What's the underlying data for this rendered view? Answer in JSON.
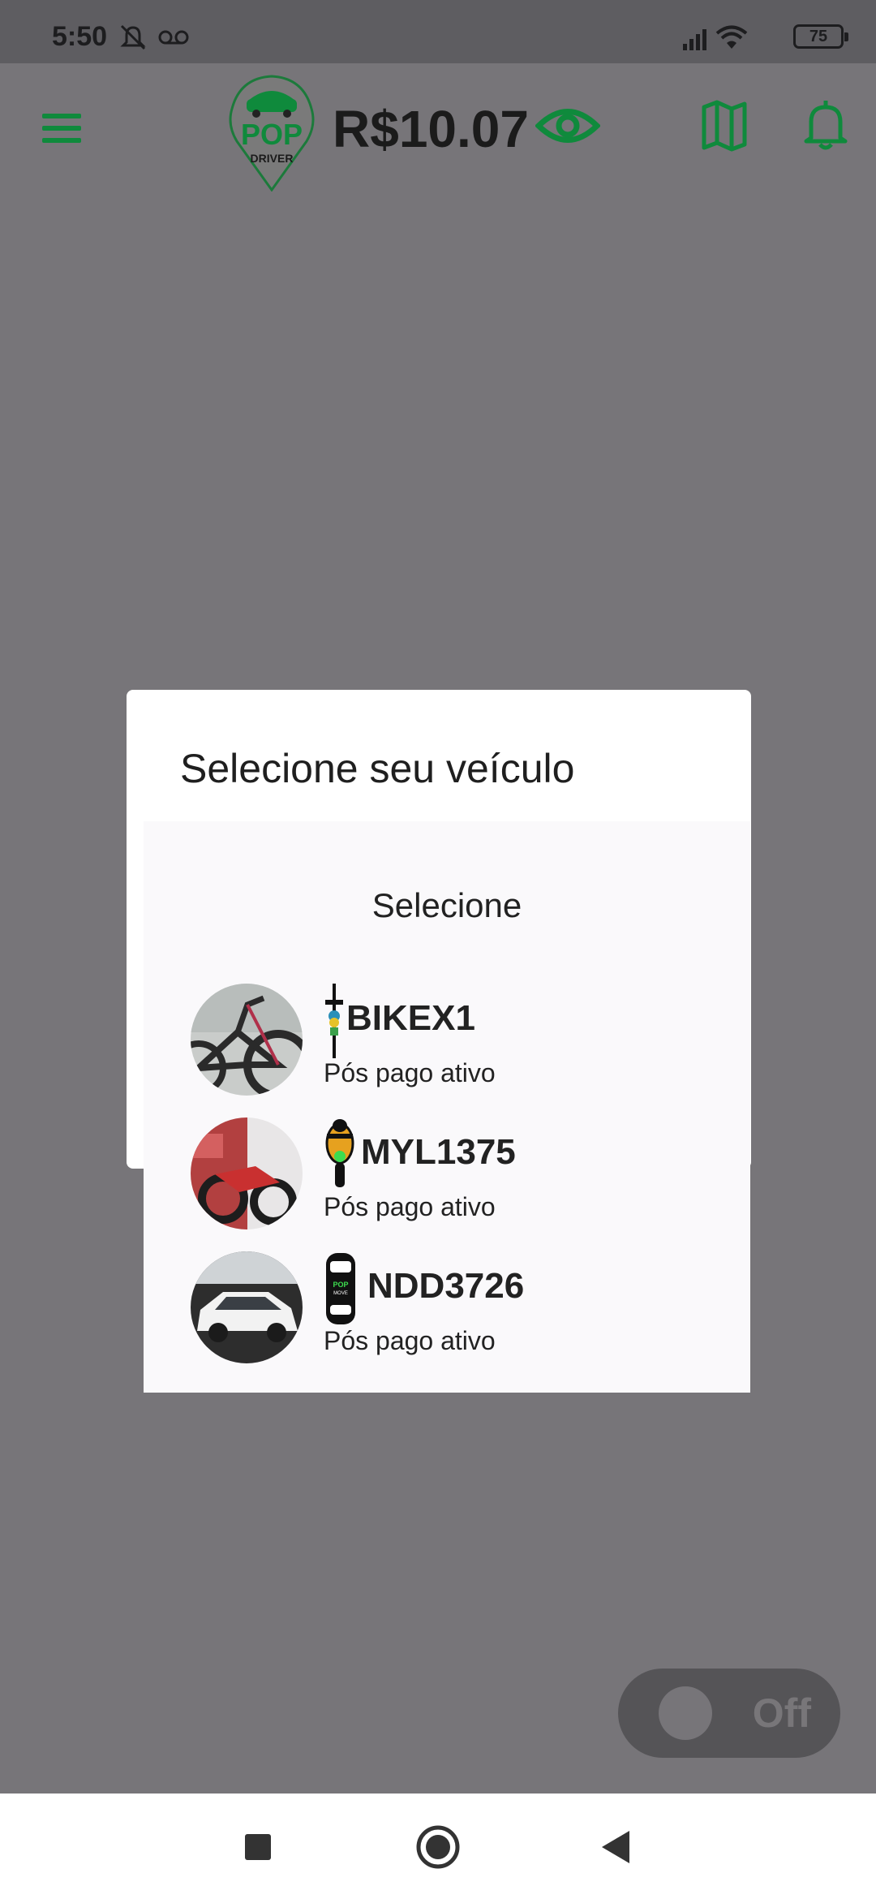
{
  "status_bar": {
    "time": "5:50",
    "battery": "75"
  },
  "header": {
    "logo_text": "POP",
    "logo_sub": "DRIVER",
    "balance": "R$10.07"
  },
  "dialog": {
    "title": "Selecione seu veículo",
    "select_label": "Selecione",
    "vehicles": [
      {
        "plate": "BIKEX1",
        "status": "Pós pago ativo",
        "type_icon": "bicycle-icon"
      },
      {
        "plate": "MYL1375",
        "status": "Pós pago ativo",
        "type_icon": "motorcycle-icon"
      },
      {
        "plate": "NDD3726",
        "status": "Pós pago ativo",
        "type_icon": "car-icon"
      }
    ]
  },
  "toggle": {
    "label": "Off"
  },
  "colors": {
    "brand_green": "#0f8a3c",
    "overlay": "#777579"
  }
}
